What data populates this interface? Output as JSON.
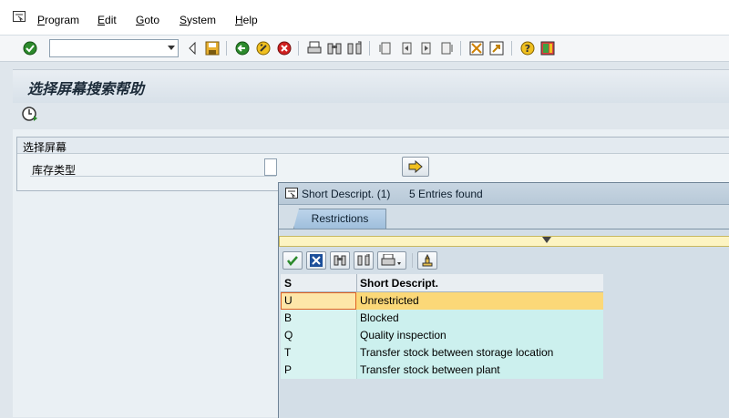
{
  "menubar": {
    "items": [
      {
        "label": "Program"
      },
      {
        "label": "Edit"
      },
      {
        "label": "Goto"
      },
      {
        "label": "System"
      },
      {
        "label": "Help"
      }
    ]
  },
  "toolbar": {
    "command_field_value": "",
    "icons": [
      "enter-icon",
      "back-icon",
      "save-icon",
      "back-green-icon",
      "exit-icon",
      "cancel-icon",
      "print-icon",
      "find-icon",
      "find-next-icon",
      "first-page-icon",
      "previous-page-icon",
      "next-page-icon",
      "last-page-icon",
      "create-session-icon",
      "shortcut-icon",
      "help-icon",
      "customize-layout-icon"
    ]
  },
  "screen": {
    "title": "选择屏幕搜索帮助",
    "group_title": "选择屏幕",
    "field_label": "库存类型",
    "field_value": ""
  },
  "popup": {
    "title": "Short Descript. (1)",
    "entries_count": "5 Entries found",
    "tab_label": "Restrictions",
    "columns": [
      "S",
      "Short Descript."
    ],
    "rows": [
      {
        "key": "U",
        "desc": "Unrestricted",
        "selected": true
      },
      {
        "key": "B",
        "desc": "Blocked",
        "selected": false
      },
      {
        "key": "Q",
        "desc": "Quality inspection",
        "selected": false
      },
      {
        "key": "T",
        "desc": "Transfer stock between storage location",
        "selected": false
      },
      {
        "key": "P",
        "desc": "Transfer stock between plant",
        "selected": false
      }
    ]
  },
  "colors": {
    "selected_row": "#fbd878",
    "grid_row": "#ccf0ee",
    "info_bar": "#fdf4c2"
  }
}
